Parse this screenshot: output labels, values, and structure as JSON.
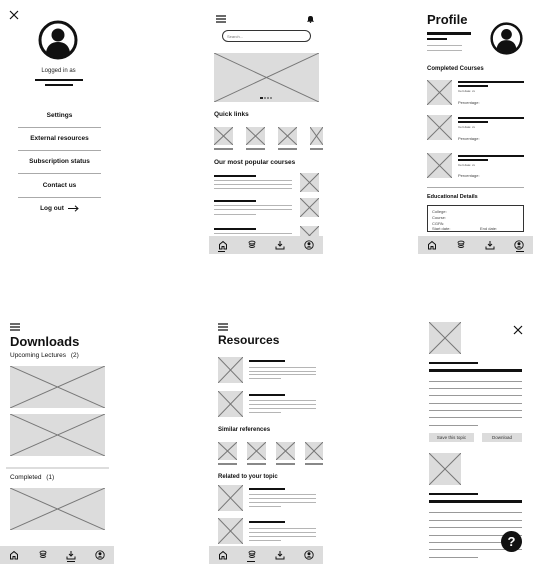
{
  "menu_screen": {
    "logged_in_label": "Logged in as",
    "items": [
      "Settings",
      "External resources",
      "Subscription status",
      "Contact us",
      "Log out"
    ],
    "icons": {
      "close": "close-icon",
      "avatar": "user-avatar-icon",
      "logout": "arrow-right-icon"
    }
  },
  "home_screen": {
    "search_placeholder": "Search...",
    "quick_links_title": "Quick links",
    "popular_title": "Our most popular courses",
    "carousel_dots": 4
  },
  "profile_screen": {
    "title": "Profile",
    "completed_title": "Completed Courses",
    "course_meta": "Cert date: xx",
    "percentage_label": "Percentage:",
    "education_title": "Educational Details",
    "education_fields": [
      "College:",
      "Course:",
      "CGPA:",
      "Start date:",
      "End date:"
    ]
  },
  "downloads_screen": {
    "title": "Downloads",
    "upcoming_label": "Upcoming Lectures",
    "upcoming_count": "(2)",
    "completed_label": "Completed",
    "completed_count": "(1)"
  },
  "resources_screen": {
    "title": "Resources",
    "similar_title": "Similar references",
    "related_title": "Related to your topic"
  },
  "detail_screen": {
    "save_label": "Save this topic",
    "download_label": "Download",
    "help_label": "?"
  },
  "bottom_nav": [
    "home-icon",
    "layers-icon",
    "download-icon",
    "profile-icon"
  ]
}
